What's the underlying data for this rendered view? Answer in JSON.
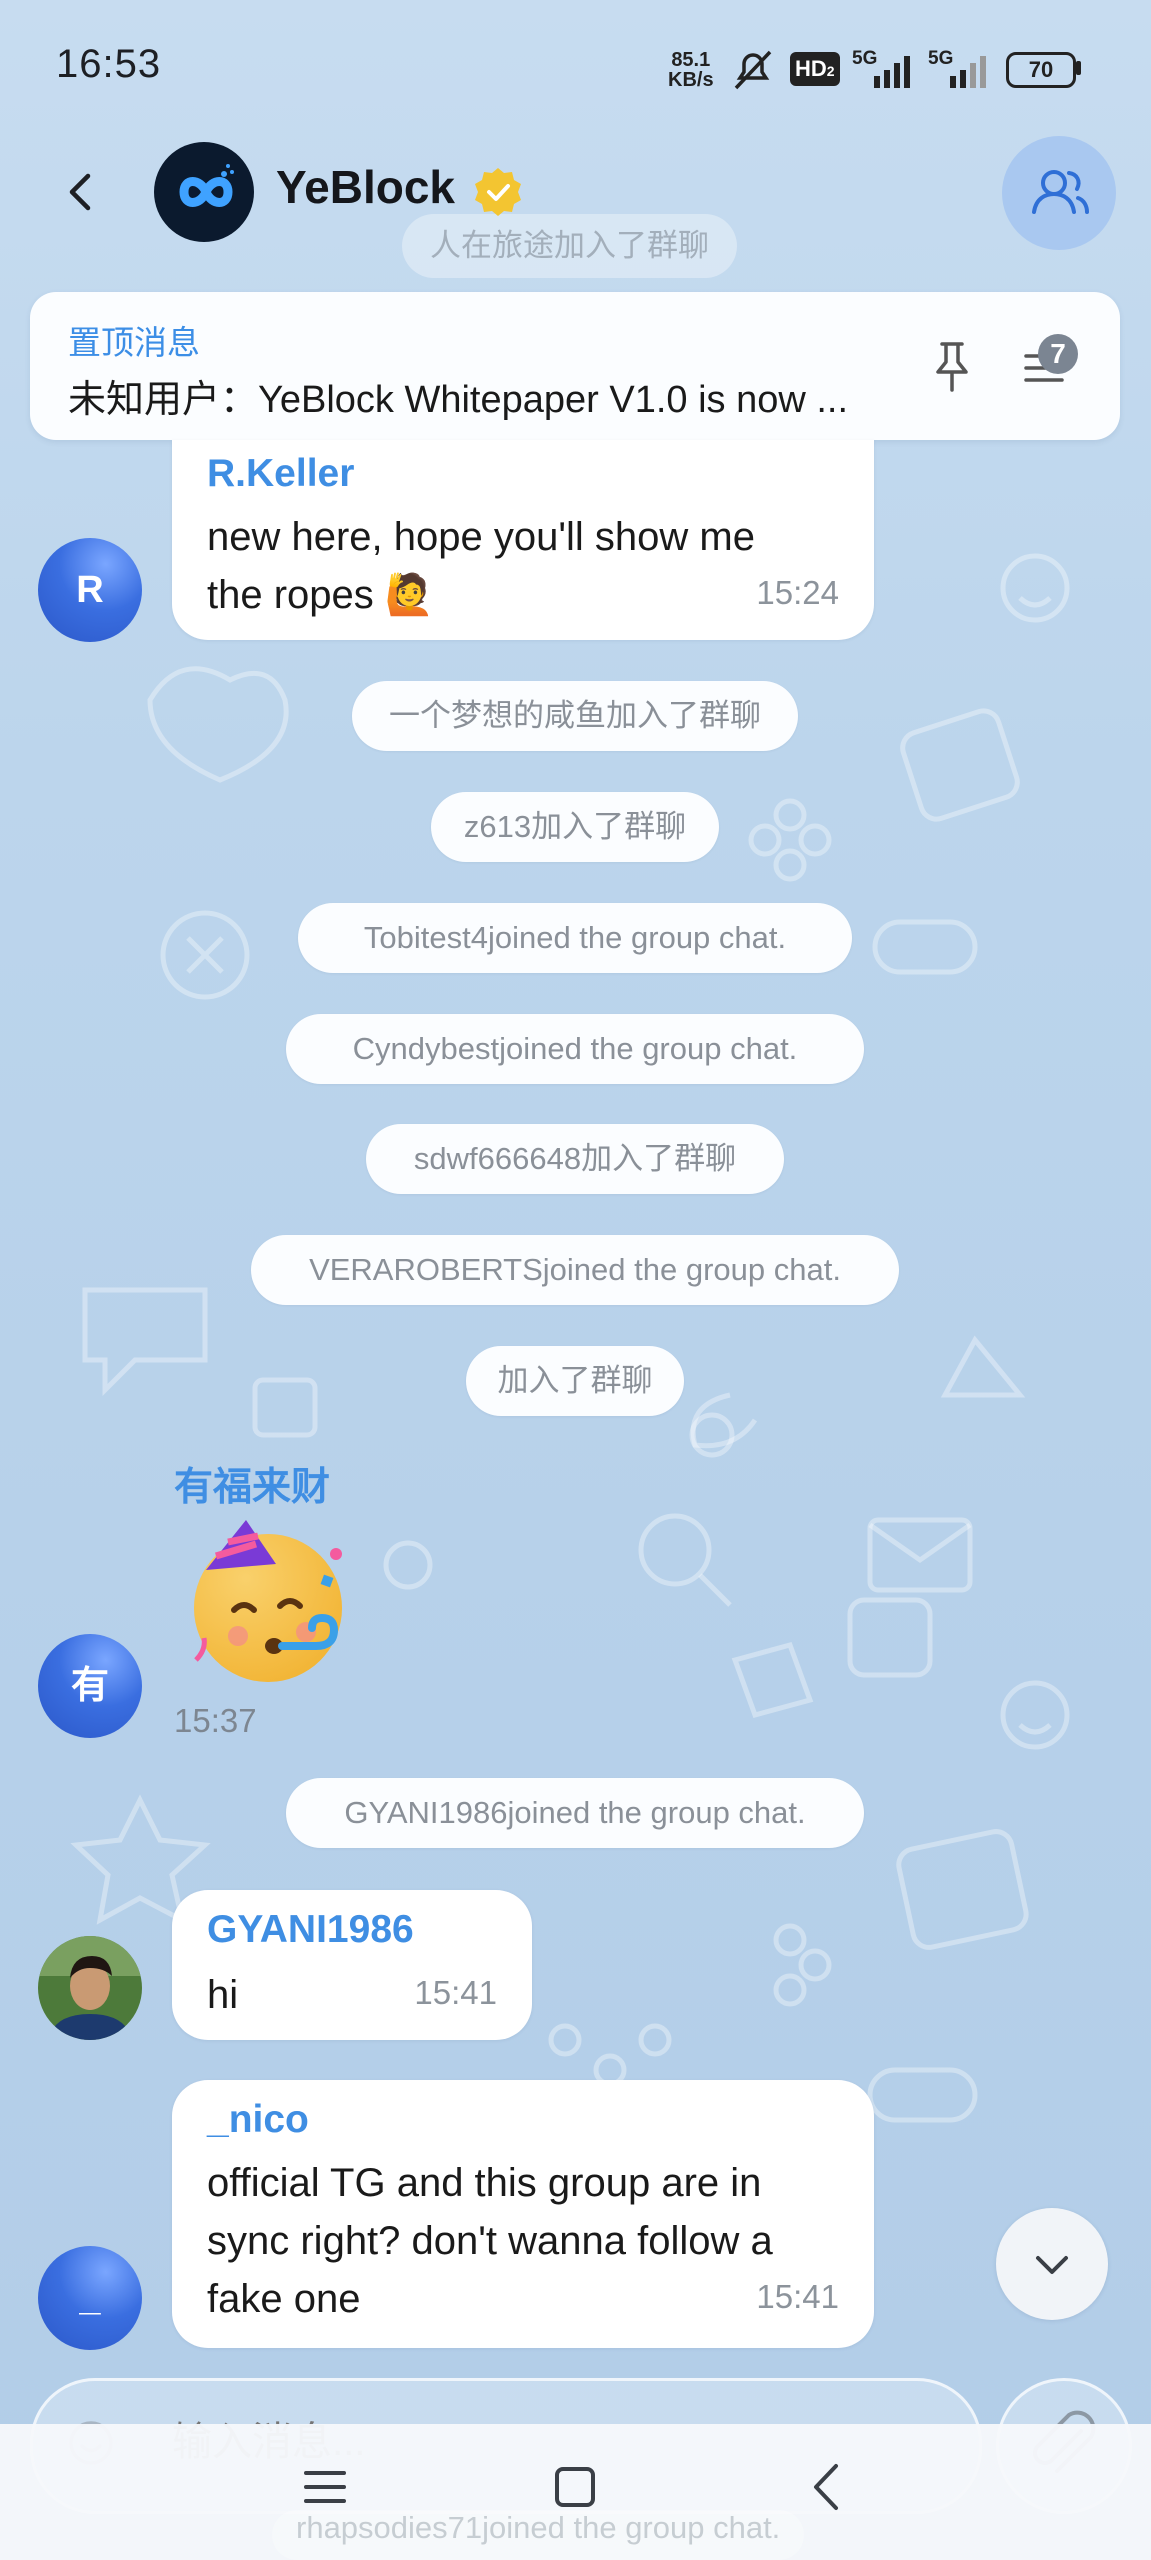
{
  "status_bar": {
    "time": "16:53",
    "net_speed_value": "85.1",
    "net_speed_unit": "KB/s",
    "hd_label": "HD",
    "hd_sub": "2",
    "signal1_label": "5G",
    "signal2_label": "5G",
    "battery": "70"
  },
  "header": {
    "group_name": "YeBlock",
    "icons": {
      "back": "chevron-left-icon",
      "verified": "verified-badge-icon",
      "members": "members-icon"
    }
  },
  "pinned": {
    "title": "置顶消息",
    "text": "未知用户：YeBlock Whitepaper V1.0 is now ...",
    "count": "7"
  },
  "ghost_top": "人在旅途加入了群聊",
  "messages": [
    {
      "avatar": "R",
      "sender": "R.Keller",
      "lines": [
        " new here, hope you'll show me",
        "the ropes 🙋"
      ],
      "time": "15:24"
    },
    {
      "avatar": "有",
      "sender": "有福来财",
      "sticker": "partying-face",
      "time": "15:37"
    },
    {
      "avatar": "photo",
      "sender": "GYANI1986",
      "lines": [
        " hi"
      ],
      "time": "15:41"
    },
    {
      "avatar": "_",
      "sender": "_nico",
      "lines": [
        " official TG and this group are in",
        "sync right? don't wanna follow a",
        "fake one"
      ],
      "time": "15:41"
    }
  ],
  "system": [
    "一个梦想的咸鱼加入了群聊",
    "z613加入了群聊",
    "Tobitest4joined the group chat.",
    "Cyndybestjoined the group chat.",
    "sdwf666648加入了群聊",
    "VERAROBERTSjoined the group chat.",
    "加入了群聊",
    "GYANI1986joined the group chat."
  ],
  "input": {
    "placeholder": "输入消息..."
  },
  "ghost_bottom": "rhapsodies71joined the group chat.",
  "colors": {
    "accent": "#3f8ee3",
    "avatar_blue": "#3a6ee0",
    "background": "#bcd5ec"
  }
}
